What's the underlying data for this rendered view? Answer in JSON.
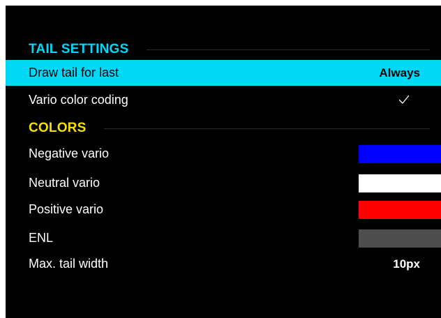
{
  "tail_settings": {
    "title": "TAIL SETTINGS",
    "title_color": "#00d8f8",
    "draw_tail": {
      "label": "Draw tail for last",
      "value": "Always"
    },
    "vario_color_coding": {
      "label": "Vario color coding",
      "checked": true,
      "icon": "checkmark-icon"
    }
  },
  "colors": {
    "title": "COLORS",
    "title_color": "#f5e000",
    "negative_vario": {
      "label": "Negative vario",
      "color": "#0000ff"
    },
    "neutral_vario": {
      "label": "Neutral vario",
      "color": "#ffffff"
    },
    "positive_vario": {
      "label": "Positive vario",
      "color": "#ff0000"
    },
    "enl": {
      "label": "ENL",
      "color": "#4d4d4d"
    }
  },
  "max_tail_width": {
    "label": "Max. tail width",
    "value": "10px"
  },
  "theme": {
    "background": "#000000",
    "selected_row": "#00d8f8",
    "text": "#ffffff"
  }
}
